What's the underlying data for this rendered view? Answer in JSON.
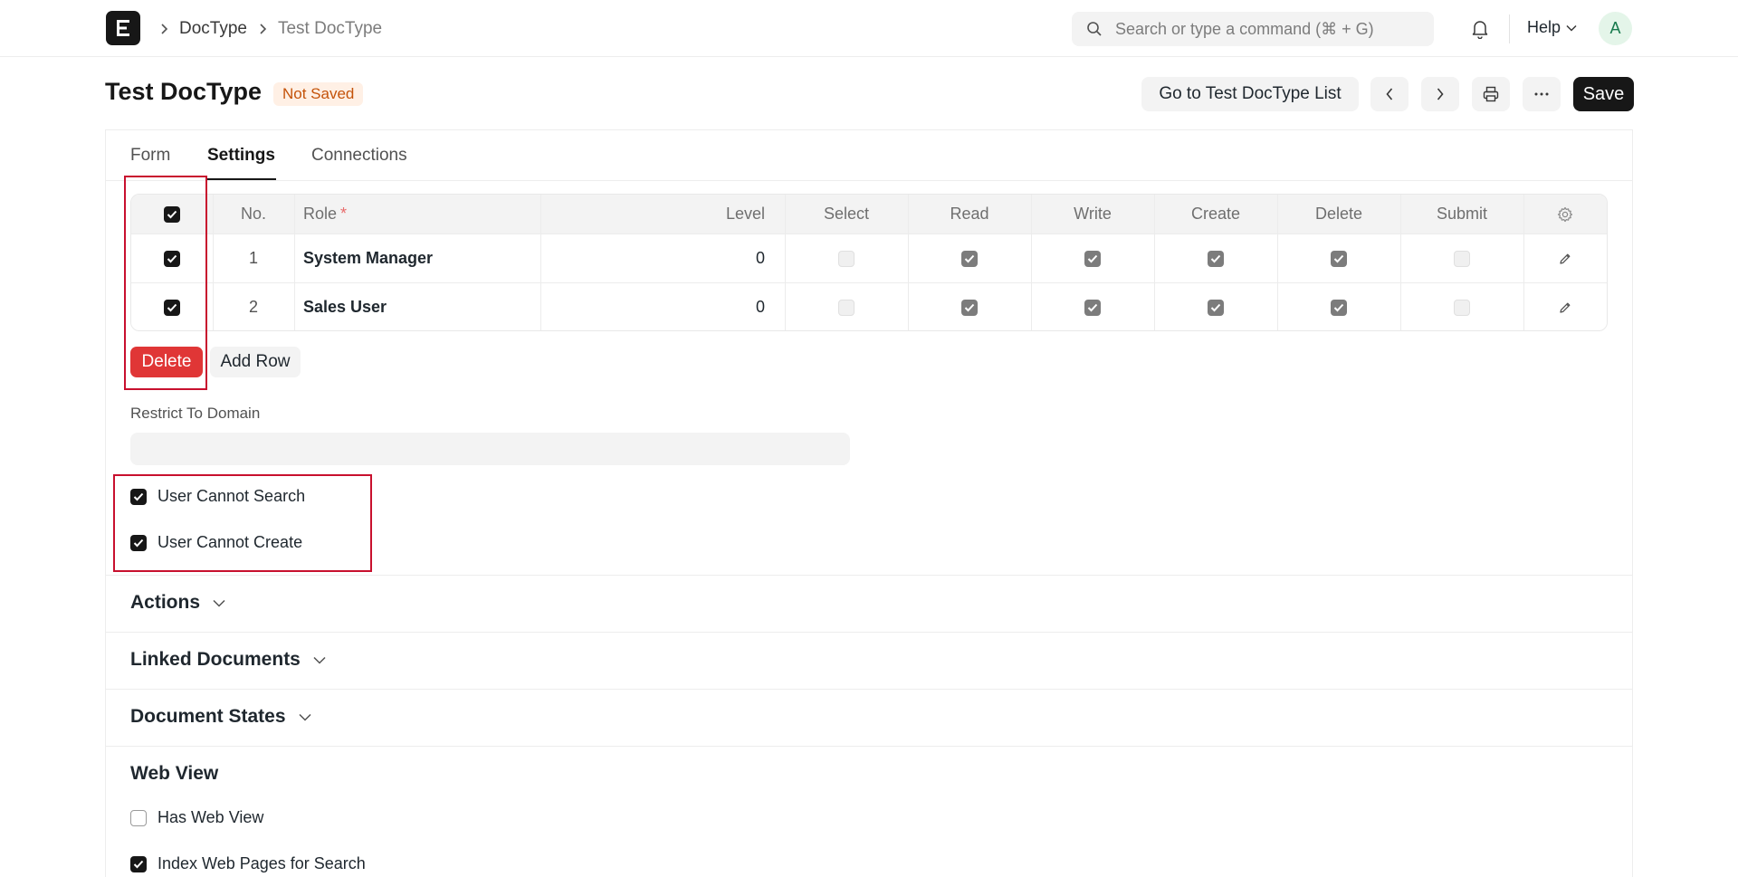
{
  "navbar": {
    "breadcrumbs": [
      "DocType",
      "Test DocType"
    ],
    "search_placeholder": "Search or type a command (⌘ + G)",
    "help_label": "Help",
    "avatar_initial": "A"
  },
  "page": {
    "title": "Test DocType",
    "status": "Not Saved",
    "list_button": "Go to Test DocType List",
    "save_button": "Save"
  },
  "tabs": [
    "Form",
    "Settings",
    "Connections"
  ],
  "active_tab": "Settings",
  "permissions_table": {
    "columns": [
      "No.",
      "Role",
      "Level",
      "Select",
      "Read",
      "Write",
      "Create",
      "Delete",
      "Submit"
    ],
    "required_marker": "*",
    "rows": [
      {
        "no": "1",
        "role": "System Manager",
        "level": "0",
        "select": false,
        "read": true,
        "write": true,
        "create": true,
        "delete": true,
        "submit": false,
        "selected": true
      },
      {
        "no": "2",
        "role": "Sales User",
        "level": "0",
        "select": false,
        "read": true,
        "write": true,
        "create": true,
        "delete": true,
        "submit": false,
        "selected": true
      }
    ],
    "delete_button": "Delete",
    "add_row_button": "Add Row"
  },
  "restrict_to_domain": {
    "label": "Restrict To Domain",
    "value": ""
  },
  "options": [
    {
      "label": "User Cannot Search",
      "checked": true
    },
    {
      "label": "User Cannot Create",
      "checked": true
    }
  ],
  "sections": {
    "actions": "Actions",
    "linked_documents": "Linked Documents",
    "document_states": "Document States",
    "web_view": "Web View"
  },
  "web_view_options": [
    {
      "label": "Has Web View",
      "checked": false
    },
    {
      "label": "Index Web Pages for Search",
      "checked": true
    }
  ],
  "colors": {
    "danger": "#e03636",
    "highlight_box": "#c8102e",
    "status_badge_bg": "#fff0e5",
    "status_badge_text": "#c4530a",
    "primary": "#171717"
  }
}
